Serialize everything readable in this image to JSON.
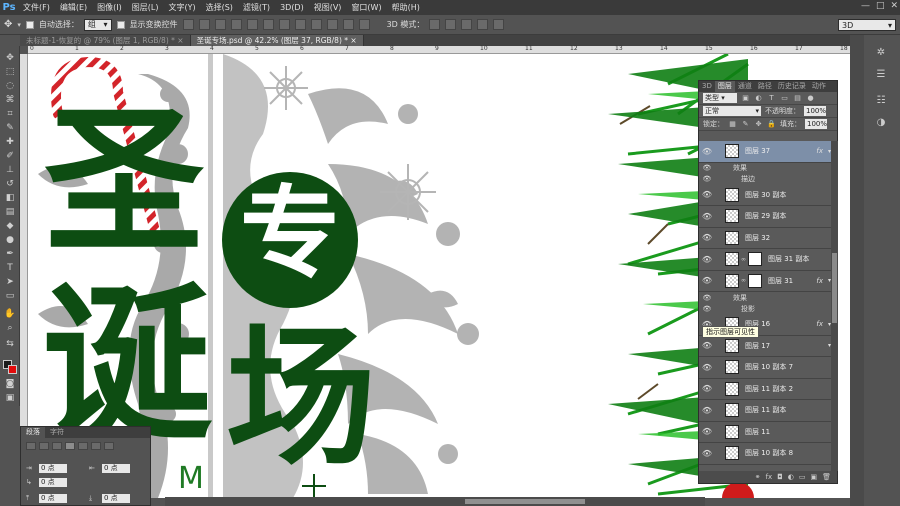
{
  "app": {
    "logo": "Ps"
  },
  "menu": [
    "文件(F)",
    "编辑(E)",
    "图像(I)",
    "图层(L)",
    "文字(Y)",
    "选择(S)",
    "滤镜(T)",
    "3D(D)",
    "视图(V)",
    "窗口(W)",
    "帮助(H)"
  ],
  "window_controls": {
    "minimize": "—",
    "maximize": "□",
    "close": "✕"
  },
  "options": {
    "auto_select_label": "自动选择：",
    "auto_select_value": "组",
    "show_transform_label": "显示变换控件",
    "mode_3d_label": "3D 模式：",
    "workspace": "3D"
  },
  "tabs": [
    {
      "label": "未标题-1-恢复的 @ 79% (图层 1, RGB/8) *",
      "close": "×"
    },
    {
      "label": "圣诞专场.psd @ 42.2% (图层 37, RGB/8) *",
      "close": "×"
    }
  ],
  "ruler_marks": [
    "0",
    "1",
    "2",
    "3",
    "4",
    "5",
    "6",
    "7",
    "8",
    "9",
    "10",
    "11",
    "12",
    "13",
    "14",
    "15",
    "16",
    "17",
    "18"
  ],
  "canvas": {
    "chars": [
      "圣",
      "诞",
      "专",
      "场"
    ],
    "partial": "M"
  },
  "layers_panel": {
    "tabs": [
      "3D",
      "图层",
      "通道",
      "路径",
      "历史记录",
      "动作"
    ],
    "kind_label": "类型",
    "blend_mode": "正常",
    "opacity_label": "不透明度：",
    "opacity_value": "100%",
    "lock_label": "锁定：",
    "fill_label": "填充：",
    "fill_value": "100%",
    "layers": [
      {
        "name": "图层 37",
        "selected": true,
        "fx": "fx"
      },
      {
        "effect": "效果"
      },
      {
        "effect_child": "描边"
      },
      {
        "name": "图层 30 副本"
      },
      {
        "name": "图层 29 副本"
      },
      {
        "name": "图层 32"
      },
      {
        "name": "图层 31 副本",
        "masked": true
      },
      {
        "name": "图层 31",
        "masked": true,
        "fx": "fx"
      },
      {
        "effect": "效果"
      },
      {
        "effect_child": "投影"
      },
      {
        "name": "图层 16",
        "fx": "fx"
      },
      {
        "name": "图层 17"
      },
      {
        "name": "图层 10 副本 7"
      },
      {
        "name": "图层 11 副本 2"
      },
      {
        "name": "图层 11 副本"
      },
      {
        "name": "图层 11"
      },
      {
        "name": "图层 10 副本 8"
      }
    ],
    "footer": [
      "⚭",
      "fx",
      "◘",
      "◐",
      "▭",
      "▣",
      "🗑"
    ]
  },
  "tooltip": "指示图层可见性",
  "paragraph_panel": {
    "tabs": [
      "段落",
      "字符"
    ],
    "fields": [
      "0 点",
      "0 点",
      "0 点",
      "0 点",
      "0 点"
    ]
  }
}
